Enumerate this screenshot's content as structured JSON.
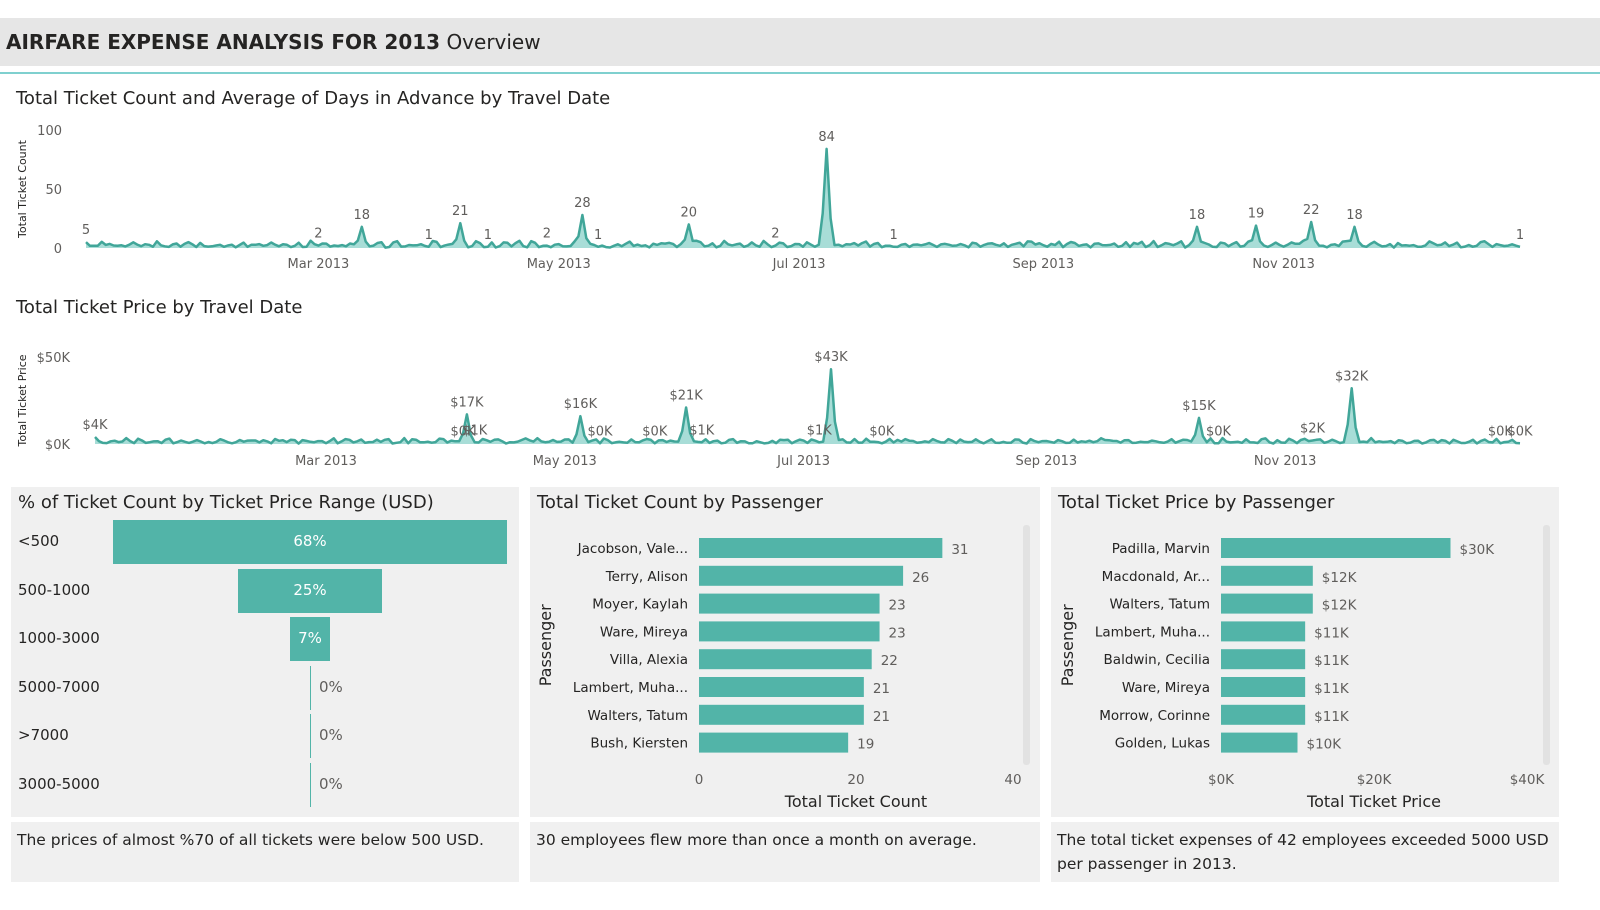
{
  "header": {
    "title_bold": "AIRFARE EXPENSE ANALYSIS FOR 2013",
    "title_rest": "Overview"
  },
  "colors": {
    "accent": "#52b4a8",
    "line": "#41a699",
    "area": "#a8ddd7",
    "panel": "#f0f0f0",
    "header": "#e6e6e6"
  },
  "charts": {
    "count_by_date": {
      "title": "Total Ticket Count and Average of Days in Advance by Travel Date",
      "ylabel": "Total Ticket Count",
      "yticks": [
        "100",
        "50",
        "0"
      ]
    },
    "price_by_date": {
      "title": "Total Ticket Price by Travel Date",
      "ylabel": "Total Ticket Price",
      "yticks": [
        "$50K",
        "$0K"
      ]
    },
    "funnel": {
      "title": "% of Ticket Count by Ticket Price Range (USD)"
    },
    "count_by_passenger": {
      "title": "Total Ticket Count by Passenger",
      "ylabel": "Passenger",
      "xlabel": "Total Ticket Count",
      "xticks": [
        "0",
        "20",
        "40"
      ]
    },
    "price_by_passenger": {
      "title": "Total Ticket Price by Passenger",
      "ylabel": "Passenger",
      "xlabel": "Total Ticket Price",
      "xticks": [
        "$0K",
        "$20K",
        "$40K"
      ]
    }
  },
  "notes": {
    "funnel": "The prices of almost %70 of all tickets were below 500 USD.",
    "count": "30 employees flew more than once a month on average.",
    "price": "The total ticket expenses of 42 employees exceeded 5000 USD per passenger in 2013."
  },
  "chart_data": [
    {
      "type": "area",
      "title": "Total Ticket Count and Average of Days in Advance by Travel Date",
      "ylabel": "Total Ticket Count",
      "ylim": [
        0,
        100
      ],
      "x_ticks": [
        "Mar 2013",
        "May 2013",
        "Jul 2013",
        "Sep 2013",
        "Nov 2013"
      ],
      "x_range": [
        "2013-01-01",
        "2013-12-31"
      ],
      "labeled_points": [
        {
          "x": "2013-01-01",
          "y": 5
        },
        {
          "x": "2013-03-01",
          "y": 2
        },
        {
          "x": "2013-03-12",
          "y": 18
        },
        {
          "x": "2013-03-29",
          "y": 1
        },
        {
          "x": "2013-04-06",
          "y": 21
        },
        {
          "x": "2013-04-13",
          "y": 1
        },
        {
          "x": "2013-04-28",
          "y": 2
        },
        {
          "x": "2013-05-07",
          "y": 28
        },
        {
          "x": "2013-05-11",
          "y": 1
        },
        {
          "x": "2013-06-03",
          "y": 20
        },
        {
          "x": "2013-06-25",
          "y": 2
        },
        {
          "x": "2013-07-08",
          "y": 84
        },
        {
          "x": "2013-07-25",
          "y": 1
        },
        {
          "x": "2013-10-10",
          "y": 18
        },
        {
          "x": "2013-10-25",
          "y": 19
        },
        {
          "x": "2013-11-08",
          "y": 22
        },
        {
          "x": "2013-11-19",
          "y": 18
        },
        {
          "x": "2013-12-31",
          "y": 1
        }
      ]
    },
    {
      "type": "area",
      "title": "Total Ticket Price by Travel Date",
      "ylabel": "Total Ticket Price",
      "ylim": [
        0,
        50000
      ],
      "x_ticks": [
        "Mar 2013",
        "May 2013",
        "Jul 2013",
        "Sep 2013",
        "Nov 2013"
      ],
      "x_range": [
        "2013-01-01",
        "2013-12-31"
      ],
      "labeled_points": [
        {
          "x": "2013-01-01",
          "y": 4000,
          "label": "$4K"
        },
        {
          "x": "2013-04-05",
          "y": 400,
          "label": "$0K"
        },
        {
          "x": "2013-04-06",
          "y": 17000,
          "label": "$17K"
        },
        {
          "x": "2013-04-08",
          "y": 1000,
          "label": "$1K"
        },
        {
          "x": "2013-05-05",
          "y": 16000,
          "label": "$16K"
        },
        {
          "x": "2013-05-10",
          "y": 400,
          "label": "$0K"
        },
        {
          "x": "2013-05-24",
          "y": 400,
          "label": "$0K"
        },
        {
          "x": "2013-06-01",
          "y": 21000,
          "label": "$21K"
        },
        {
          "x": "2013-06-05",
          "y": 1000,
          "label": "$1K"
        },
        {
          "x": "2013-07-05",
          "y": 1000,
          "label": "$1K"
        },
        {
          "x": "2013-07-08",
          "y": 43000,
          "label": "$43K"
        },
        {
          "x": "2013-07-21",
          "y": 400,
          "label": "$0K"
        },
        {
          "x": "2013-10-10",
          "y": 15000,
          "label": "$15K"
        },
        {
          "x": "2013-10-15",
          "y": 400,
          "label": "$0K"
        },
        {
          "x": "2013-11-08",
          "y": 2000,
          "label": "$2K"
        },
        {
          "x": "2013-11-18",
          "y": 32000,
          "label": "$32K"
        },
        {
          "x": "2013-12-26",
          "y": 400,
          "label": "$0K"
        },
        {
          "x": "2013-12-31",
          "y": 400,
          "label": "$0K"
        }
      ]
    },
    {
      "type": "bar",
      "subtype": "funnel",
      "title": "% of Ticket Count by Ticket Price Range (USD)",
      "categories": [
        "<500",
        "500-1000",
        "1000-3000",
        "5000-7000",
        ">7000",
        "3000-5000"
      ],
      "values": [
        68,
        25,
        7,
        0,
        0,
        0
      ],
      "labels": [
        "68%",
        "25%",
        "7%",
        "0%",
        "0%",
        "0%"
      ]
    },
    {
      "type": "bar",
      "orientation": "horizontal",
      "title": "Total Ticket Count by Passenger",
      "xlabel": "Total Ticket Count",
      "ylabel": "Passenger",
      "xlim": [
        0,
        40
      ],
      "categories": [
        "Jacobson, Vale...",
        "Terry, Alison",
        "Moyer, Kaylah",
        "Ware, Mireya",
        "Villa, Alexia",
        "Lambert, Muha...",
        "Walters, Tatum",
        "Bush, Kiersten"
      ],
      "values": [
        31,
        26,
        23,
        23,
        22,
        21,
        21,
        19
      ],
      "labels": [
        "31",
        "26",
        "23",
        "23",
        "22",
        "21",
        "21",
        "19"
      ]
    },
    {
      "type": "bar",
      "orientation": "horizontal",
      "title": "Total Ticket Price by Passenger",
      "xlabel": "Total Ticket Price",
      "ylabel": "Passenger",
      "xlim": [
        0,
        40000
      ],
      "categories": [
        "Padilla, Marvin",
        "Macdonald, Ar...",
        "Walters, Tatum",
        "Lambert, Muha...",
        "Baldwin, Cecilia",
        "Ware, Mireya",
        "Morrow, Corinne",
        "Golden, Lukas"
      ],
      "values": [
        30000,
        12000,
        12000,
        11000,
        11000,
        11000,
        11000,
        10000
      ],
      "labels": [
        "$30K",
        "$12K",
        "$12K",
        "$11K",
        "$11K",
        "$11K",
        "$11K",
        "$10K"
      ]
    }
  ]
}
